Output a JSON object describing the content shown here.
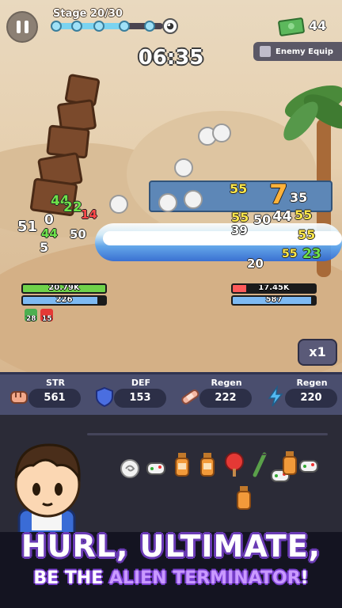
{
  "hud": {
    "stage_label": "Stage 20/30",
    "stage_progress_fraction": 0.66,
    "cash_count": "44",
    "timer": "06:35",
    "enemy_equip_label": "Enemy Equip",
    "pause_icon": "pause-icon",
    "boss_icon": "cat-boss-icon",
    "cash_icon": "cash-stack-icon"
  },
  "battle": {
    "player": {
      "hp_text": "20.79K",
      "hp_fraction": 1.0,
      "hp_color": "#6fd24a",
      "shield_text": "226",
      "shield_fraction": 0.9,
      "shield_color": "#7db9f2",
      "buffs": [
        {
          "icon": "green-potion-icon",
          "count": "28",
          "color": "#4caf50"
        },
        {
          "icon": "red-potion-icon",
          "count": "15",
          "color": "#e53935"
        }
      ]
    },
    "enemy": {
      "hp_text": "17.45K",
      "hp_fraction": 0.16,
      "hp_color": "#ff5a5a",
      "shield_text": "587",
      "shield_fraction": 0.95,
      "shield_color": "#7db9f2"
    },
    "damage_numbers": [
      {
        "text": "44",
        "color": "green"
      },
      {
        "text": "22",
        "color": "green"
      },
      {
        "text": "14",
        "color": "red"
      },
      {
        "text": "51",
        "color": "white"
      },
      {
        "text": "0",
        "color": "white"
      },
      {
        "text": "44",
        "color": "green"
      },
      {
        "text": "50",
        "color": "white"
      },
      {
        "text": "5",
        "color": "white"
      },
      {
        "text": "55",
        "color": "yellow"
      },
      {
        "text": "7",
        "color": "orange"
      },
      {
        "text": "35",
        "color": "white"
      },
      {
        "text": "55",
        "color": "yellow"
      },
      {
        "text": "50",
        "color": "white"
      },
      {
        "text": "44",
        "color": "white"
      },
      {
        "text": "55",
        "color": "yellow"
      },
      {
        "text": "39",
        "color": "white"
      },
      {
        "text": "55",
        "color": "yellow"
      },
      {
        "text": "20",
        "color": "white"
      },
      {
        "text": "55",
        "color": "yellow"
      },
      {
        "text": "23",
        "color": "green"
      }
    ],
    "speed_label": "x1"
  },
  "stats": [
    {
      "name": "STR",
      "value": "561",
      "icon": "fist-icon",
      "color": "#f2a88a"
    },
    {
      "name": "DEF",
      "value": "153",
      "icon": "shield-icon",
      "color": "#4a6ee0"
    },
    {
      "name": "Regen",
      "value": "222",
      "icon": "bandage-icon",
      "color": "#f4b7a2"
    },
    {
      "name": "Regen",
      "value": "220",
      "icon": "lightning-icon",
      "color": "#53b9f2"
    }
  ],
  "inventory": {
    "items": [
      {
        "icon": "swirl-cloud-icon"
      },
      {
        "icon": "game-controller-icon"
      },
      {
        "icon": "orange-bottle-icon"
      },
      {
        "icon": "orange-bottle-icon"
      },
      {
        "icon": "ping-pong-paddle-icon"
      },
      {
        "icon": "fork-icon"
      },
      {
        "icon": "orange-bottle-icon"
      },
      {
        "icon": "game-controller-icon"
      },
      {
        "icon": "game-controller-icon"
      }
    ]
  },
  "promo": {
    "line1": "HURL, ULTIMATE,",
    "line2_prefix": "BE THE ",
    "line2_accent": "ALIEN TERMINATOR",
    "line2_suffix": "!"
  }
}
